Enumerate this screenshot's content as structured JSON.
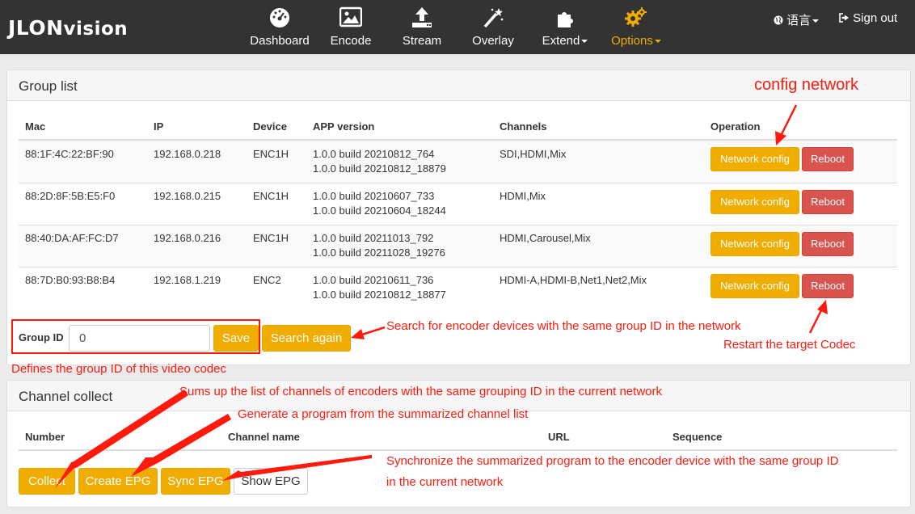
{
  "brand": {
    "name": "JLONvision"
  },
  "nav": {
    "dashboard": "Dashboard",
    "encode": "Encode",
    "stream": "Stream",
    "overlay": "Overlay",
    "extend": "Extend",
    "options": "Options",
    "language": "语言",
    "signout": "Sign out"
  },
  "group_panel": {
    "title": "Group list",
    "headers": {
      "mac": "Mac",
      "ip": "IP",
      "device": "Device",
      "app": "APP version",
      "channels": "Channels",
      "operation": "Operation"
    },
    "rows": [
      {
        "mac": "88:1F:4C:22:BF:90",
        "ip": "192.168.0.218",
        "device": "ENC1H",
        "app1": "1.0.0 build 20210812_764",
        "app2": "1.0.0 build 20210812_18879",
        "channels": "SDI,HDMI,Mix"
      },
      {
        "mac": "88:2D:8F:5B:E5:F0",
        "ip": "192.168.0.215",
        "device": "ENC1H",
        "app1": "1.0.0 build 20210607_733",
        "app2": "1.0.0 build 20210604_18244",
        "channels": "HDMI,Mix"
      },
      {
        "mac": "88:40:DA:AF:FC:D7",
        "ip": "192.168.0.216",
        "device": "ENC1H",
        "app1": "1.0.0 build 20211013_792",
        "app2": "1.0.0 build 20211028_19276",
        "channels": "HDMI,Carousel,Mix"
      },
      {
        "mac": "88:7D:B0:93:B8:B4",
        "ip": "192.168.1.219",
        "device": "ENC2",
        "app1": "1.0.0 build 20210611_736",
        "app2": "1.0.0 build 20210812_18877",
        "channels": "HDMI-A,HDMI-B,Net1,Net2,Mix"
      }
    ],
    "network_config_label": "Network config",
    "reboot_label": "Reboot",
    "group_id_label": "Group ID",
    "group_id_value": "0",
    "save_label": "Save",
    "search_again_label": "Search again"
  },
  "channel_panel": {
    "title": "Channel collect",
    "headers": {
      "number": "Number",
      "name": "Channel name",
      "url": "URL",
      "sequence": "Sequence"
    },
    "collect_label": "Collect",
    "create_epg_label": "Create EPG",
    "sync_epg_label": "Sync EPG",
    "show_epg_label": "Show EPG"
  },
  "annotations": {
    "config_network": "config network",
    "search": "Search for encoder devices with the same group ID in the network",
    "restart": "Restart the target Codec",
    "defines": "Defines the group ID of this video codec",
    "sums": "Sums up the list of channels of encoders with the same grouping ID in the current network",
    "generate": "Generate a program from the summarized channel list",
    "sync1": "Synchronize the summarized program to the encoder device with the same group ID",
    "sync2": "in the current network"
  },
  "colors": {
    "navbar": "#333333",
    "accent": "#f0ad00",
    "danger": "#d9534f",
    "annotation": "#ff1a0e"
  }
}
